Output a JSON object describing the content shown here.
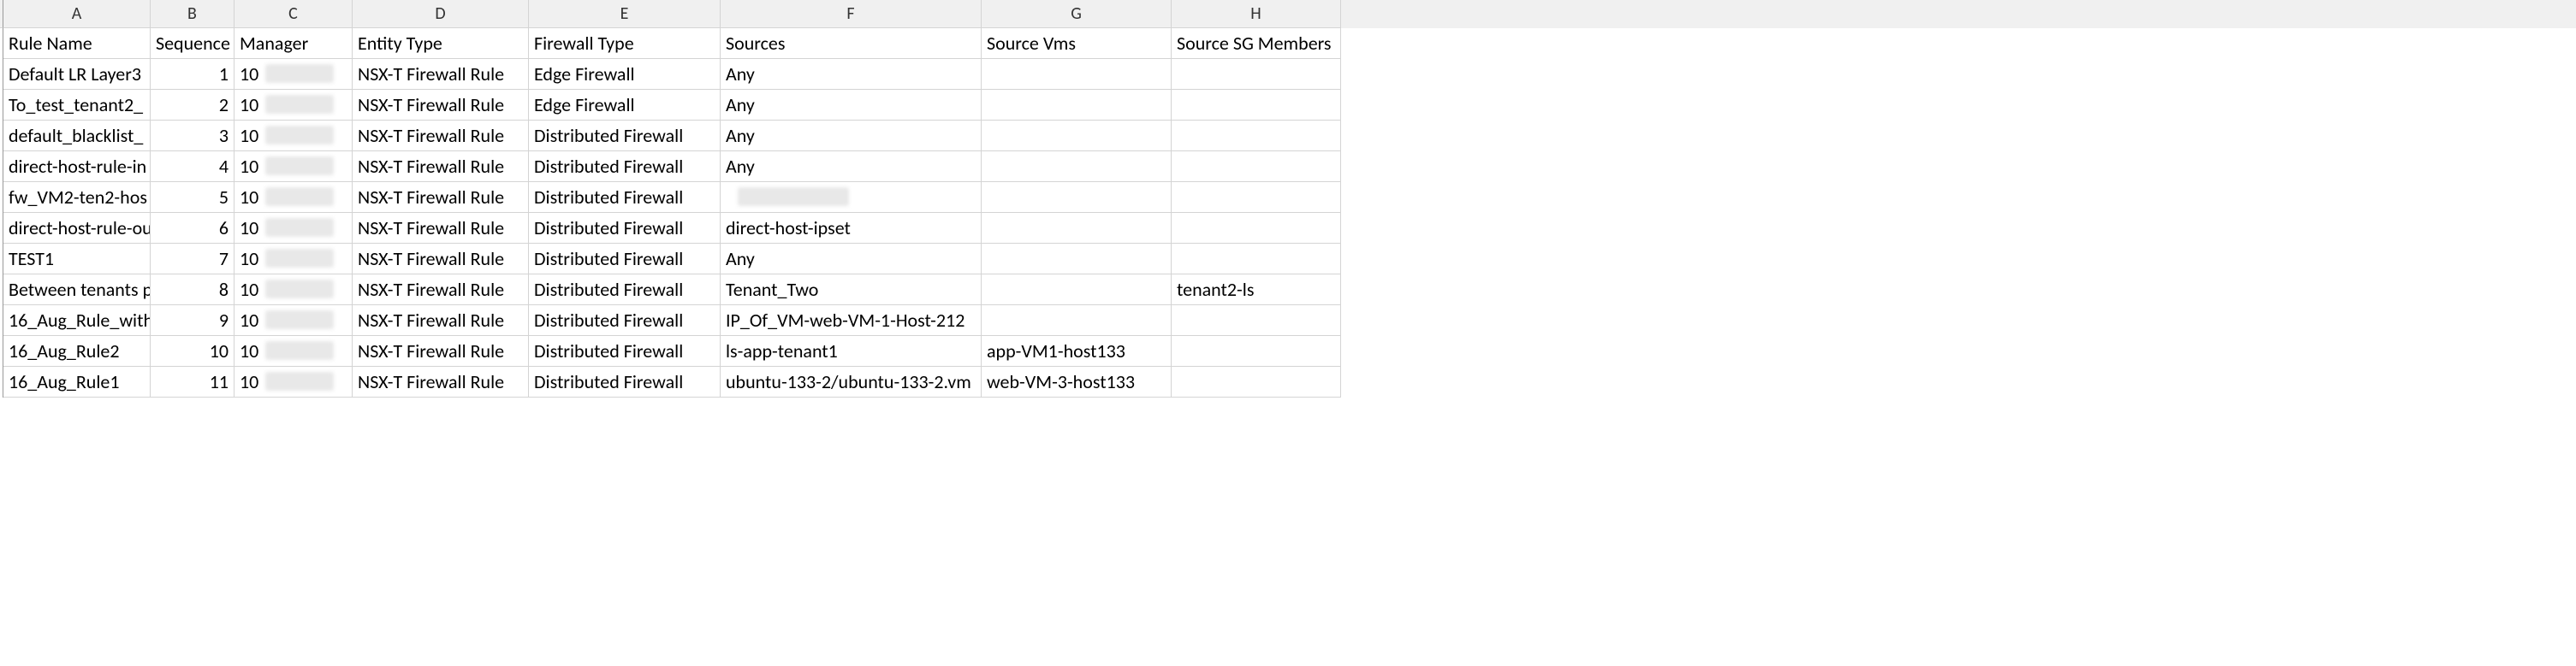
{
  "columns": [
    "A",
    "B",
    "C",
    "D",
    "E",
    "F",
    "G",
    "H"
  ],
  "header_row": {
    "A": "Rule Name",
    "B": "Sequence",
    "C": "Manager",
    "D": "Entity Type",
    "E": "Firewall Type",
    "F": "Sources",
    "G": "Source Vms",
    "H": "Source SG Members"
  },
  "rows": [
    {
      "A": "Default LR Layer3",
      "B": "1",
      "C": "10",
      "D": "NSX-T Firewall Rule",
      "E": "Edge Firewall",
      "F": "Any",
      "G": "",
      "H": ""
    },
    {
      "A": "To_test_tenant2_",
      "B": "2",
      "C": "10",
      "D": "NSX-T Firewall Rule",
      "E": "Edge Firewall",
      "F": "Any",
      "G": "",
      "H": ""
    },
    {
      "A": "default_blacklist_",
      "B": "3",
      "C": "10",
      "D": "NSX-T Firewall Rule",
      "E": "Distributed Firewall",
      "F": "Any",
      "G": "",
      "H": ""
    },
    {
      "A": "direct-host-rule-in",
      "B": "4",
      "C": "10",
      "D": "NSX-T Firewall Rule",
      "E": "Distributed Firewall",
      "F": "Any",
      "G": "",
      "H": ""
    },
    {
      "A": "fw_VM2-ten2-hos",
      "B": "5",
      "C": "10",
      "D": "NSX-T Firewall Rule",
      "E": "Distributed Firewall",
      "F": "",
      "G": "",
      "H": ""
    },
    {
      "A": "direct-host-rule-ou",
      "B": "6",
      "C": "10",
      "D": "NSX-T Firewall Rule",
      "E": "Distributed Firewall",
      "F": "direct-host-ipset",
      "G": "",
      "H": ""
    },
    {
      "A": "TEST1",
      "B": "7",
      "C": "10",
      "D": "NSX-T Firewall Rule",
      "E": "Distributed Firewall",
      "F": "Any",
      "G": "",
      "H": ""
    },
    {
      "A": "Between tenants p",
      "B": "8",
      "C": "10",
      "D": "NSX-T Firewall Rule",
      "E": "Distributed Firewall",
      "F": "Tenant_Two",
      "G": "",
      "H": "tenant2-ls"
    },
    {
      "A": "16_Aug_Rule_with",
      "B": "9",
      "C": "10",
      "D": "NSX-T Firewall Rule",
      "E": "Distributed Firewall",
      "F": "IP_Of_VM-web-VM-1-Host-212",
      "G": "",
      "H": ""
    },
    {
      "A": "16_Aug_Rule2",
      "B": "10",
      "C": "10",
      "D": "NSX-T Firewall Rule",
      "E": "Distributed Firewall",
      "F": "ls-app-tenant1",
      "G": "app-VM1-host133",
      "H": ""
    },
    {
      "A": "16_Aug_Rule1",
      "B": "11",
      "C": "10",
      "D": "NSX-T Firewall Rule",
      "E": "Distributed Firewall",
      "F": "ubuntu-133-2/ubuntu-133-2.vm",
      "G": "web-VM-3-host133",
      "H": ""
    }
  ]
}
